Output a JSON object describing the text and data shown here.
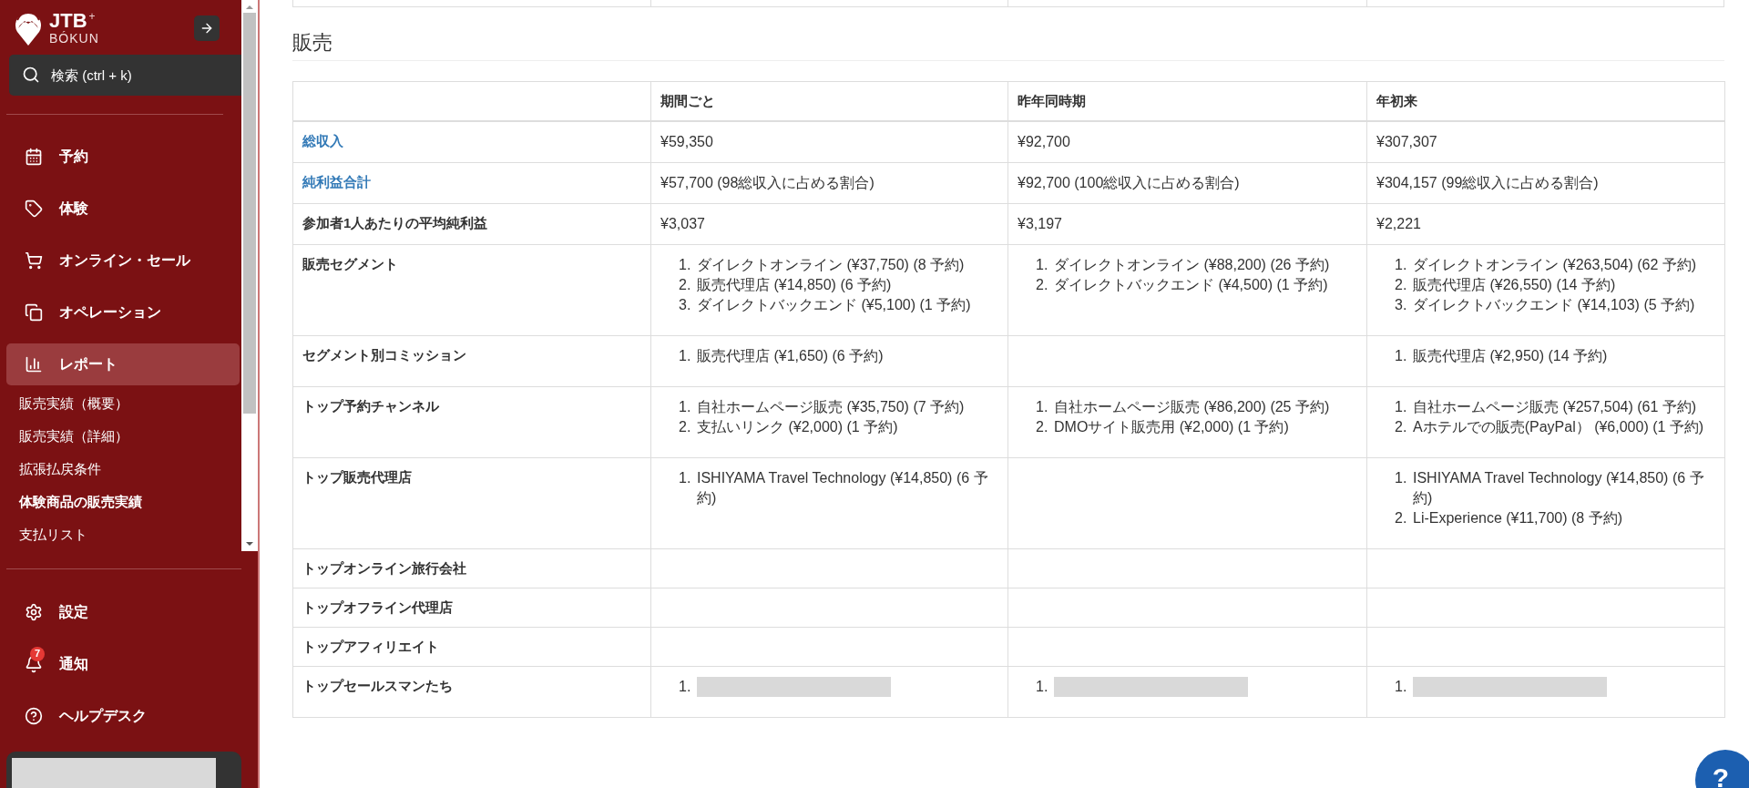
{
  "sidebar": {
    "logo": {
      "title": "JTB",
      "plus": "+",
      "subtitle": "BÓKUN"
    },
    "search": {
      "placeholder": "検索 (ctrl + k)"
    },
    "nav_items": [
      {
        "label": "予約",
        "selected": false
      },
      {
        "label": "体験",
        "selected": false
      },
      {
        "label": "オンライン・セール",
        "selected": false
      },
      {
        "label": "オペレーション",
        "selected": false
      },
      {
        "label": "レポート",
        "selected": true
      }
    ],
    "report_subitems": [
      {
        "label": "販売実績（概要）",
        "selected": false
      },
      {
        "label": "販売実績（詳細）",
        "selected": false
      },
      {
        "label": "拡張払戻条件",
        "selected": false
      },
      {
        "label": "体験商品の販売実績",
        "selected": true
      },
      {
        "label": "支払リスト",
        "selected": false
      }
    ],
    "bottom_items": [
      {
        "label": "設定"
      },
      {
        "label": "通知",
        "badge": "7"
      },
      {
        "label": "ヘルプデスク"
      }
    ]
  },
  "section": {
    "title": "販売"
  },
  "table": {
    "columns": [
      "期間ごと",
      "昨年同時期",
      "年初来"
    ],
    "rows": [
      {
        "label": "総収入",
        "link": true,
        "cells": [
          {
            "kind": "text",
            "text": "¥59,350"
          },
          {
            "kind": "text",
            "text": "¥92,700"
          },
          {
            "kind": "text",
            "text": "¥307,307"
          }
        ]
      },
      {
        "label": "純利益合計",
        "link": true,
        "cells": [
          {
            "kind": "text",
            "text": "¥57,700 (98総収入に占める割合)"
          },
          {
            "kind": "text",
            "text": "¥92,700 (100総収入に占める割合)"
          },
          {
            "kind": "text",
            "text": "¥304,157 (99総収入に占める割合)"
          }
        ]
      },
      {
        "label": "参加者1人あたりの平均純利益",
        "link": false,
        "cells": [
          {
            "kind": "text",
            "text": "¥3,037"
          },
          {
            "kind": "text",
            "text": "¥3,197"
          },
          {
            "kind": "text",
            "text": "¥2,221"
          }
        ]
      },
      {
        "label": "販売セグメント",
        "link": false,
        "cells": [
          {
            "kind": "list",
            "items": [
              {
                "num": "1.",
                "text": "ダイレクトオンライン (¥37,750) (8 予約)"
              },
              {
                "num": "2.",
                "text": "販売代理店 (¥14,850) (6 予約)"
              },
              {
                "num": "3.",
                "text": "ダイレクトバックエンド (¥5,100) (1 予約)"
              }
            ]
          },
          {
            "kind": "list",
            "items": [
              {
                "num": "1.",
                "text": "ダイレクトオンライン (¥88,200) (26 予約)"
              },
              {
                "num": "2.",
                "text": "ダイレクトバックエンド (¥4,500) (1 予約)"
              }
            ]
          },
          {
            "kind": "list",
            "items": [
              {
                "num": "1.",
                "text": "ダイレクトオンライン (¥263,504) (62 予約)"
              },
              {
                "num": "2.",
                "text": "販売代理店 (¥26,550) (14 予約)"
              },
              {
                "num": "3.",
                "text": "ダイレクトバックエンド (¥14,103) (5 予約)"
              }
            ]
          }
        ]
      },
      {
        "label": "セグメント別コミッション",
        "link": false,
        "cells": [
          {
            "kind": "list",
            "items": [
              {
                "num": "1.",
                "text": "販売代理店 (¥1,650) (6 予約)"
              }
            ]
          },
          {
            "kind": "empty"
          },
          {
            "kind": "list",
            "items": [
              {
                "num": "1.",
                "text": "販売代理店 (¥2,950) (14 予約)"
              }
            ]
          }
        ]
      },
      {
        "label": "トップ予約チャンネル",
        "link": false,
        "cells": [
          {
            "kind": "list",
            "items": [
              {
                "num": "1.",
                "text": "自社ホームページ販売 (¥35,750) (7 予約)"
              },
              {
                "num": "2.",
                "text": "支払いリンク (¥2,000) (1 予約)"
              }
            ]
          },
          {
            "kind": "list",
            "items": [
              {
                "num": "1.",
                "text": "自社ホームページ販売 (¥86,200) (25 予約)"
              },
              {
                "num": "2.",
                "text": "DMOサイト販売用 (¥2,000) (1 予約)"
              }
            ]
          },
          {
            "kind": "list",
            "items": [
              {
                "num": "1.",
                "text": "自社ホームページ販売 (¥257,504) (61 予約)"
              },
              {
                "num": "2.",
                "text": "Aホテルでの販売(PayPal） (¥6,000) (1 予約)"
              }
            ]
          }
        ]
      },
      {
        "label": "トップ販売代理店",
        "link": false,
        "cells": [
          {
            "kind": "list",
            "items": [
              {
                "num": "1.",
                "text": "ISHIYAMA Travel Technology (¥14,850) (6 予約)"
              }
            ]
          },
          {
            "kind": "empty"
          },
          {
            "kind": "list",
            "items": [
              {
                "num": "1.",
                "text": "ISHIYAMA Travel Technology (¥14,850) (6 予約)"
              },
              {
                "num": "2.",
                "text": "Li-Experience (¥11,700) (8 予約)"
              }
            ]
          }
        ]
      },
      {
        "label": "トップオンライン旅行会社",
        "link": false,
        "cells": [
          {
            "kind": "empty"
          },
          {
            "kind": "empty"
          },
          {
            "kind": "empty"
          }
        ]
      },
      {
        "label": "トップオフライン代理店",
        "link": false,
        "cells": [
          {
            "kind": "empty"
          },
          {
            "kind": "empty"
          },
          {
            "kind": "empty"
          }
        ]
      },
      {
        "label": "トップアフィリエイト",
        "link": false,
        "cells": [
          {
            "kind": "empty"
          },
          {
            "kind": "empty"
          },
          {
            "kind": "empty"
          }
        ]
      },
      {
        "label": "トップセールスマンたち",
        "link": false,
        "cells": [
          {
            "kind": "list",
            "items": [
              {
                "num": "1.",
                "kind": "redacted"
              }
            ]
          },
          {
            "kind": "list",
            "items": [
              {
                "num": "1.",
                "kind": "redacted"
              }
            ]
          },
          {
            "kind": "list",
            "items": [
              {
                "num": "1.",
                "kind": "redacted"
              }
            ]
          }
        ]
      }
    ]
  },
  "help_button": {
    "label": "?"
  }
}
